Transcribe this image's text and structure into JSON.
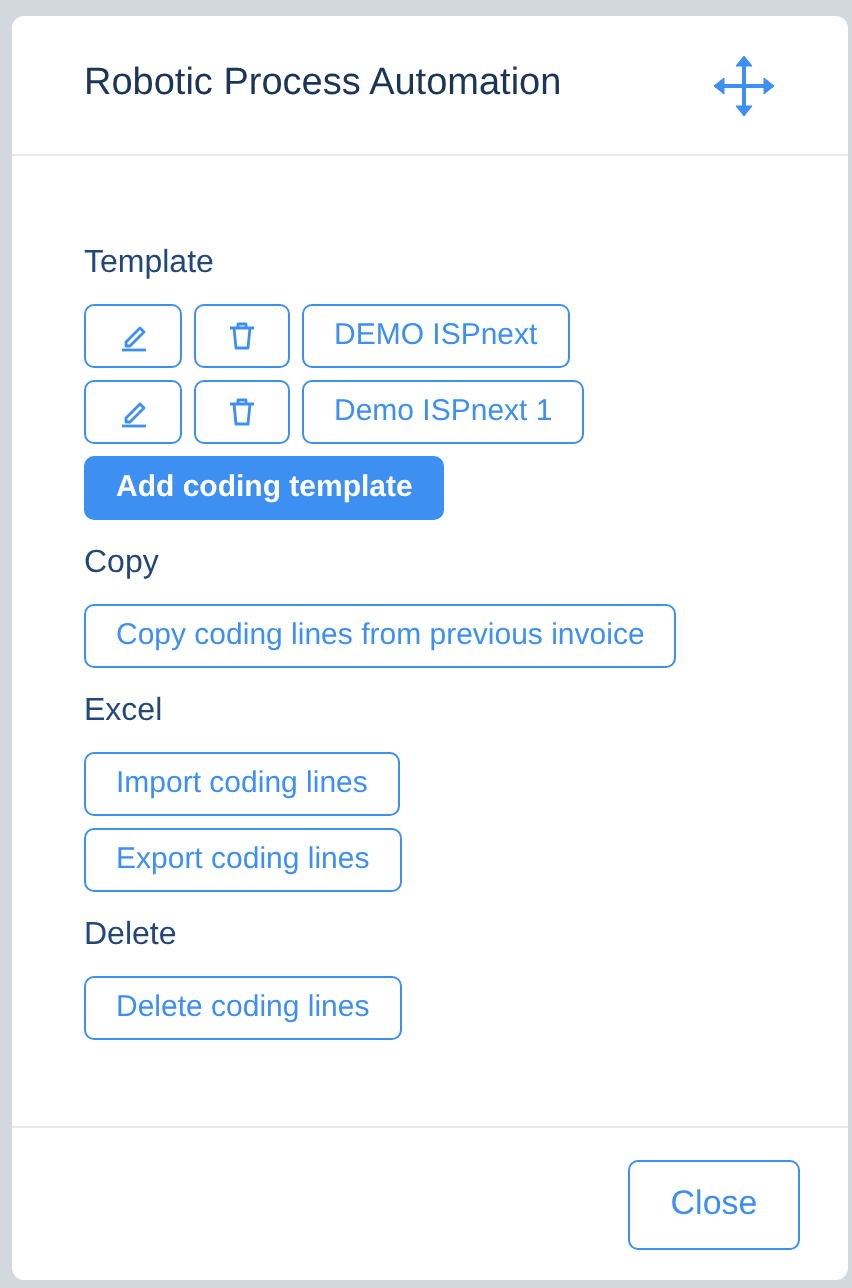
{
  "dialog": {
    "title": "Robotic Process Automation"
  },
  "sections": [
    {
      "heading": "Template",
      "items": [
        {
          "kind": "template",
          "name": "DEMO ISPnext"
        },
        {
          "kind": "template",
          "name": "Demo ISPnext 1"
        },
        {
          "kind": "primary",
          "label": "Add coding template"
        }
      ]
    },
    {
      "heading": "Copy",
      "items": [
        {
          "kind": "outline",
          "label": "Copy coding lines from previous invoice"
        }
      ]
    },
    {
      "heading": "Excel",
      "items": [
        {
          "kind": "outline",
          "label": "Import coding lines"
        },
        {
          "kind": "outline",
          "label": "Export coding lines"
        }
      ]
    },
    {
      "heading": "Delete",
      "items": [
        {
          "kind": "outline",
          "label": "Delete coding lines"
        }
      ]
    }
  ],
  "footer": {
    "close_label": "Close"
  }
}
